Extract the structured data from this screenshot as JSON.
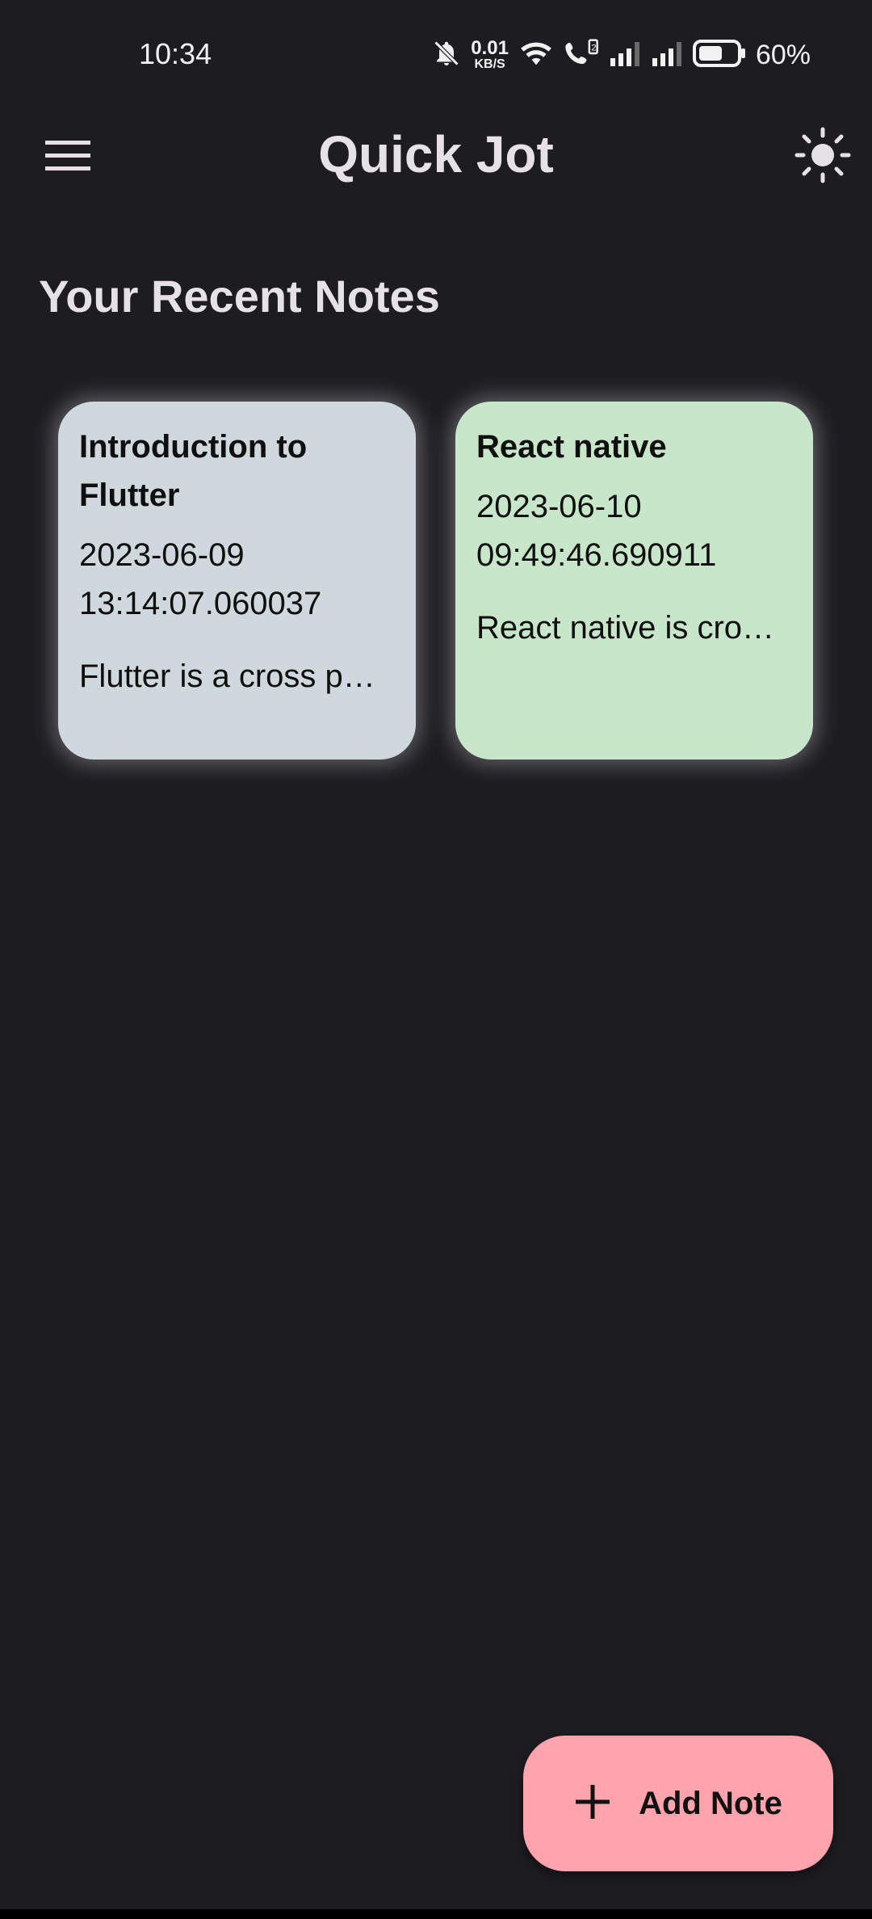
{
  "status_bar": {
    "time": "10:34",
    "net_speed_value": "0.01",
    "net_speed_unit": "KB/S",
    "battery_percent": "60%",
    "icons": [
      "bell-off-icon",
      "wifi-icon",
      "wifi-call-icon",
      "signal-icon",
      "signal-icon",
      "battery-icon"
    ]
  },
  "app_bar": {
    "title": "Quick Jot",
    "menu_icon": "menu-icon",
    "theme_icon": "sun-icon"
  },
  "section": {
    "title": "Your Recent Notes"
  },
  "notes": [
    {
      "title": "Introduction to Flutter",
      "date": "2023-06-09",
      "time": "13:14:07.060037",
      "body": "Flutter is a cross p…",
      "color": "#cfd8dc"
    },
    {
      "title": "React native",
      "date": "2023-06-10",
      "time": "09:49:46.690911",
      "body": "React native is cro…",
      "color": "#c8e6c9"
    }
  ],
  "fab": {
    "label": "Add Note",
    "icon": "plus-icon",
    "color": "#ffa4ad"
  },
  "colors": {
    "background": "#1d1c21",
    "text": "#e6e1e6"
  }
}
